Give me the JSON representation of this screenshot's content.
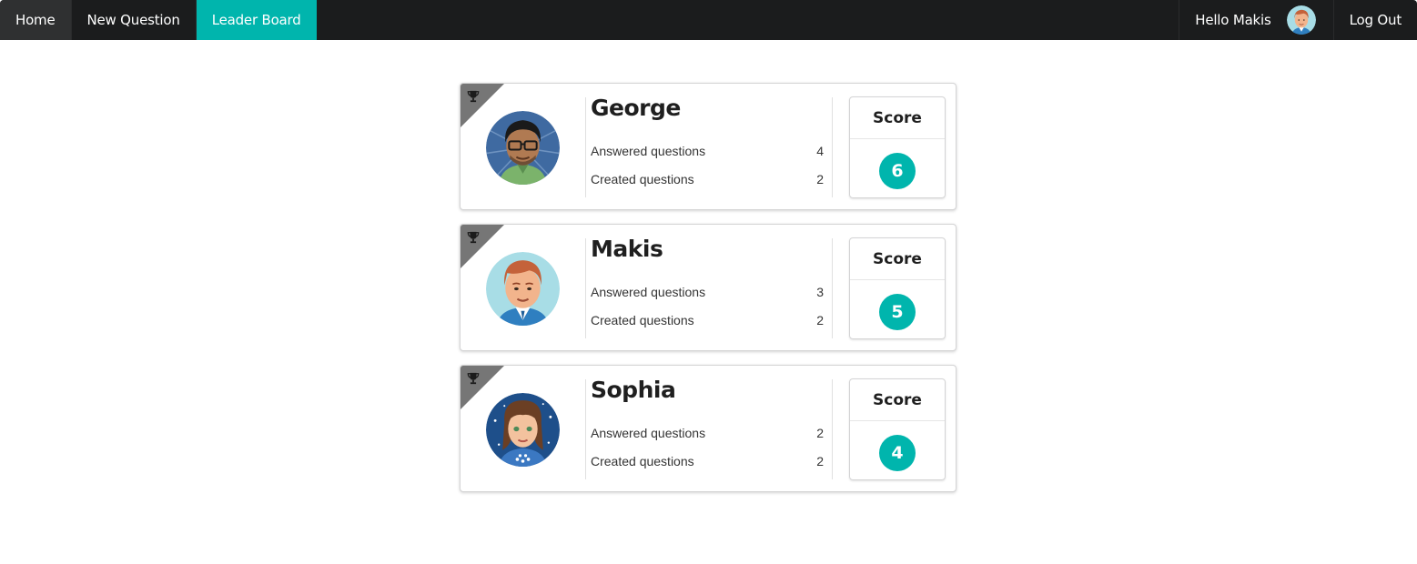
{
  "nav": {
    "home": "Home",
    "new_question": "New Question",
    "leader_board": "Leader Board",
    "greeting": "Hello Makis",
    "logout": "Log Out",
    "active_tab": "Leader Board",
    "accent_color": "#00b5ad"
  },
  "leaderboard": {
    "score_label": "Score",
    "trophy_icon": "trophy-icon",
    "entries": [
      {
        "name": "George",
        "answered_label": "Answered questions",
        "answered": "4",
        "created_label": "Created questions",
        "created": "2",
        "score": "6",
        "avatar": "man-glasses-avatar"
      },
      {
        "name": "Makis",
        "answered_label": "Answered questions",
        "answered": "3",
        "created_label": "Created questions",
        "created": "2",
        "score": "5",
        "avatar": "man-red-hair-avatar"
      },
      {
        "name": "Sophia",
        "answered_label": "Answered questions",
        "answered": "2",
        "created_label": "Created questions",
        "created": "2",
        "score": "4",
        "avatar": "woman-brown-hair-avatar"
      }
    ]
  }
}
